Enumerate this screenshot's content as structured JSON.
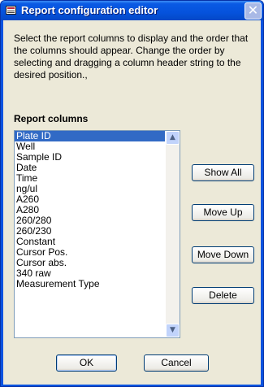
{
  "window": {
    "title": "Report configuration editor",
    "close_glyph": "✕"
  },
  "instructions": "Select the report columns to display and the order that the columns should appear.  Change the order by selecting and dragging a column header string to the desired position.,",
  "list": {
    "heading": "Report columns",
    "items": [
      "Plate ID",
      "Well",
      "Sample ID",
      "Date",
      "Time",
      "ng/ul",
      "A260",
      "A280",
      "260/280",
      "260/230",
      "Constant",
      "Cursor Pos.",
      "Cursor abs.",
      "340 raw",
      "Measurement Type"
    ],
    "selected_index": 0,
    "scroll_up_glyph": "▲",
    "scroll_down_glyph": "▼"
  },
  "buttons": {
    "show_all": "Show All",
    "move_up": "Move Up",
    "move_down": "Move Down",
    "delete": "Delete",
    "ok": "OK",
    "cancel": "Cancel"
  },
  "colors": {
    "titlebar": "#0552dc",
    "selection": "#316ac5",
    "dialog_face": "#ece9d8"
  },
  "icons": {
    "app": "report-app-icon",
    "close": "close-icon"
  }
}
